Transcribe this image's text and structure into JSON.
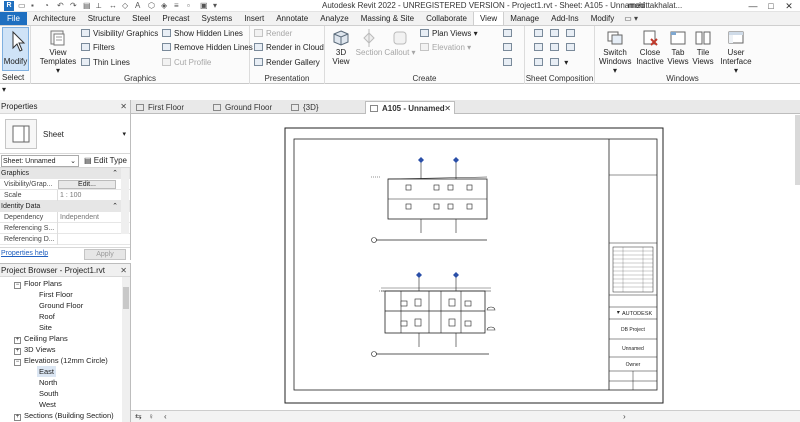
{
  "titlebar": {
    "logo": "R",
    "title": "Autodesk Revit 2022 - UNREGISTERED VERSION - Project1.rvt - Sheet: A105 - Unnamed",
    "user": "mohittakhalat...",
    "minimize": "—",
    "maximize": "□",
    "close": "✕"
  },
  "tabs": [
    "File",
    "Architecture",
    "Structure",
    "Steel",
    "Precast",
    "Systems",
    "Insert",
    "Annotate",
    "Analyze",
    "Massing & Site",
    "Collaborate",
    "View",
    "Manage",
    "Add-Ins",
    "Modify"
  ],
  "active_tab": "View",
  "tab_control": "▭ ▾",
  "ribbon": {
    "modify_label": "Modify",
    "select_label": "Select",
    "view_templates": "View Templates",
    "visibility_graphics": "Visibility/ Graphics",
    "filters": "Filters",
    "thin_lines": "Thin Lines",
    "show_hidden_lines": "Show Hidden Lines",
    "remove_hidden_lines": "Remove Hidden Lines",
    "cut_profile": "Cut Profile",
    "graphics_title": "Graphics",
    "render": "Render",
    "render_in_cloud": "Render in Cloud",
    "render_gallery": "Render Gallery",
    "presentation_title": "Presentation",
    "view_3d": "3D View",
    "section": "Section",
    "callout": "Callout",
    "plan_views": "Plan Views",
    "elevation": "Elevation",
    "create_title": "Create",
    "sheet_composition_title": "Sheet Composition",
    "switch_windows": "Switch Windows",
    "close_inactive": "Close Inactive",
    "tab_views": "Tab Views",
    "tile_views": "Tile Views",
    "user_interface": "User Interface",
    "windows_title": "Windows"
  },
  "properties": {
    "title": "Properties",
    "type_name": "Sheet",
    "instance_select": "Sheet: Unnamed",
    "edit_type": "Edit Type",
    "rows": {
      "graphics_section": "Graphics",
      "vis_label": "Visibility/Grap...",
      "vis_button": "Edit...",
      "scale_label": "Scale",
      "scale_value": "1 : 100",
      "identity_section": "Identity Data",
      "dependency_label": "Dependency",
      "dependency_value": "Independent",
      "refsheet_label": "Referencing S...",
      "refdetail_label": "Referencing D..."
    },
    "help_link": "Properties help",
    "apply": "Apply"
  },
  "browser": {
    "title": "Project Browser - Project1.rvt",
    "floor_plans": "Floor Plans",
    "first_floor": "First Floor",
    "ground_floor": "Ground Floor",
    "roof": "Roof",
    "site": "Site",
    "ceiling_plans": "Ceiling Plans",
    "views_3d": "3D Views",
    "elevations": "Elevations (12mm Circle)",
    "east": "East",
    "north": "North",
    "south": "South",
    "west": "West",
    "sections": "Sections (Building Section)"
  },
  "view_tabs": [
    {
      "label": "First Floor"
    },
    {
      "label": "Ground Floor"
    },
    {
      "label": "{3D}"
    },
    {
      "label": "A105 - Unnamed"
    }
  ],
  "sheet": {
    "brand": "AUTODESK",
    "project": "DB Project",
    "name": "Unnamed",
    "owner": "Owner"
  }
}
